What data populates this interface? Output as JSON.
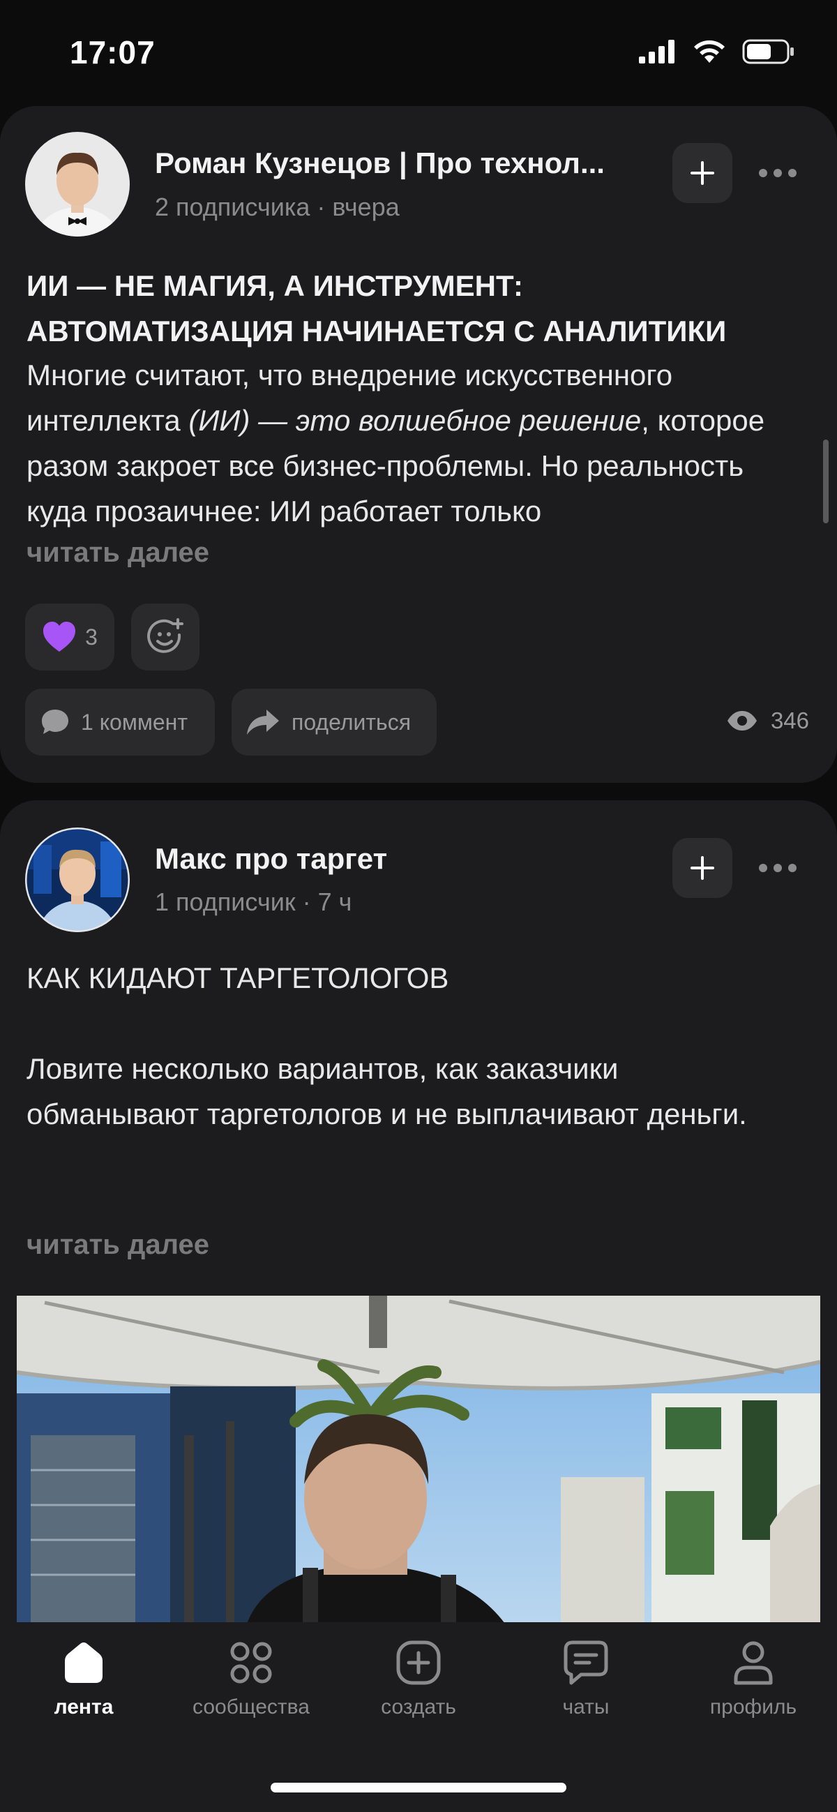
{
  "status_bar": {
    "time": "17:07"
  },
  "posts": [
    {
      "author": "Роман Кузнецов | Про технол...",
      "subscribers": "2 подписчика",
      "time": "вчера",
      "title_line1": "ИИ — НЕ МАГИЯ, А ИНСТРУМЕНТ:",
      "title_line2": "АВТОМАТИЗАЦИЯ НАЧИНАЕТСЯ С АНАЛИТИКИ",
      "text_part1": "Многие считают, что внедрение искусственного интеллекта ",
      "text_italic": "(ИИ) — это волшебное решение",
      "text_part2": ", которое разом закроет все бизнес-проблемы. Но реальность куда прозаичнее: ИИ работает только",
      "read_more": "читать далее",
      "reaction_count": "3",
      "comments": "1 коммент",
      "share": "поделиться",
      "views": "346"
    },
    {
      "author": "Макс про таргет",
      "subscribers": "1 подписчик",
      "time": "7 ч",
      "heading": "КАК КИДАЮТ ТАРГЕТОЛОГОВ",
      "text": "Ловите несколько вариантов, как заказчики обманывают таргетологов и не выплачивают деньги.",
      "read_more": "читать далее"
    }
  ],
  "meta_separator": "·",
  "tabs": [
    {
      "label": "лента",
      "icon": "home-icon",
      "active": true
    },
    {
      "label": "сообщества",
      "icon": "grid-icon",
      "active": false
    },
    {
      "label": "создать",
      "icon": "plus-square-icon",
      "active": false
    },
    {
      "label": "чаты",
      "icon": "chat-icon",
      "active": false
    },
    {
      "label": "профиль",
      "icon": "person-icon",
      "active": false
    }
  ],
  "colors": {
    "background": "#0c0c0c",
    "card": "#1c1c1e",
    "pill": "#2a2a2c",
    "muted_text": "#8b8b8e",
    "heart": "#a855f7"
  }
}
